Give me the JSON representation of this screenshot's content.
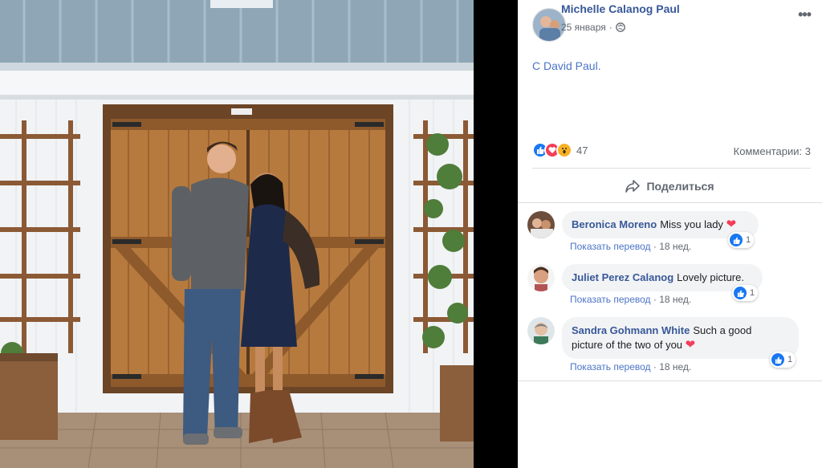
{
  "post": {
    "author": "Michelle Calanog Paul",
    "date": "25 января",
    "text": "С David Paul.",
    "reaction_count": "47",
    "comments_label": "Комментарии: 3",
    "share_label": "Поделиться",
    "reaction_icons": [
      "like-icon",
      "love-icon",
      "wow-icon"
    ]
  },
  "comments": [
    {
      "author": "Beronica Moreno",
      "text": "Miss you lady",
      "suffix": "❤",
      "reactions": "1",
      "translate": "Показать перевод",
      "time": "18 нед."
    },
    {
      "author": "Juliet Perez Calanog",
      "text": "Lovely picture.",
      "suffix": "",
      "reactions": "1",
      "translate": "Показать перевод",
      "time": "18 нед."
    },
    {
      "author": "Sandra Gohmann White",
      "text_line1": "Such a good",
      "text_line2": "picture of the two of you",
      "suffix": "❤",
      "reactions": "1",
      "translate": "Показать перевод",
      "time": "18 нед."
    }
  ],
  "colors": {
    "link": "#385898",
    "accent": "#1877f2",
    "love": "#f33e58",
    "meta": "#616770"
  }
}
